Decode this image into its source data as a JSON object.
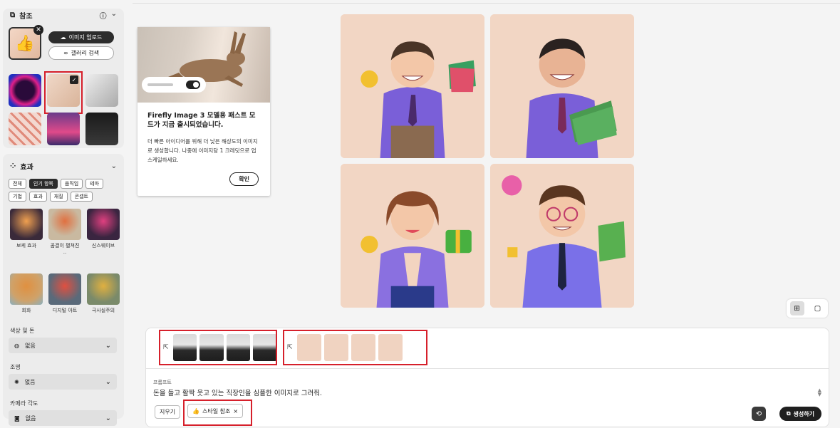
{
  "reference_panel": {
    "title": "참조",
    "upload_button": "이미지 업로드",
    "gallery_button": "갤러리 검색"
  },
  "effects_panel": {
    "title": "효과",
    "filters_row1": [
      "전체",
      "인기 항목",
      "움직임",
      "테마"
    ],
    "filters_row2": [
      "기법",
      "효과",
      "재질",
      "콘셉트"
    ],
    "active_filter": "인기 항목",
    "items": [
      {
        "label": "보케 효과",
        "color": "#3a2a3a"
      },
      {
        "label": "꿈결이 펼쳐진 ..",
        "color": "#c9b9a0"
      },
      {
        "label": "신스웨이브",
        "color": "#3a2540"
      },
      {
        "label": "회화",
        "color": "#cfa26a"
      },
      {
        "label": "디지털 아트",
        "color": "#5a6a7a"
      },
      {
        "label": "극사실주의",
        "color": "#7a8a6a"
      }
    ],
    "color_tone": {
      "label": "색상 및 톤",
      "value": "없음"
    },
    "lighting": {
      "label": "조명",
      "value": "없음"
    },
    "camera_angle": {
      "label": "카메라 각도",
      "value": "없음"
    }
  },
  "notice": {
    "title": "Firefly Image 3 모델용 패스트 모드가 지금 출시되었습니다.",
    "body": "더 빠른 아이디어를 위해 더 낮은 해상도의 이미지로 생성합니다. 나중에 이미지당 1 크레딧으로 업스케일하세요.",
    "ok_button": "확인"
  },
  "prompt_panel": {
    "label": "프롬프트",
    "text": "돈을 들고 활짝 웃고 있는 직장인을 심플한 이미지로 그려줘.",
    "clear_button": "지우기",
    "style_tag": "스타일 참조",
    "generate_button": "생성하기"
  }
}
